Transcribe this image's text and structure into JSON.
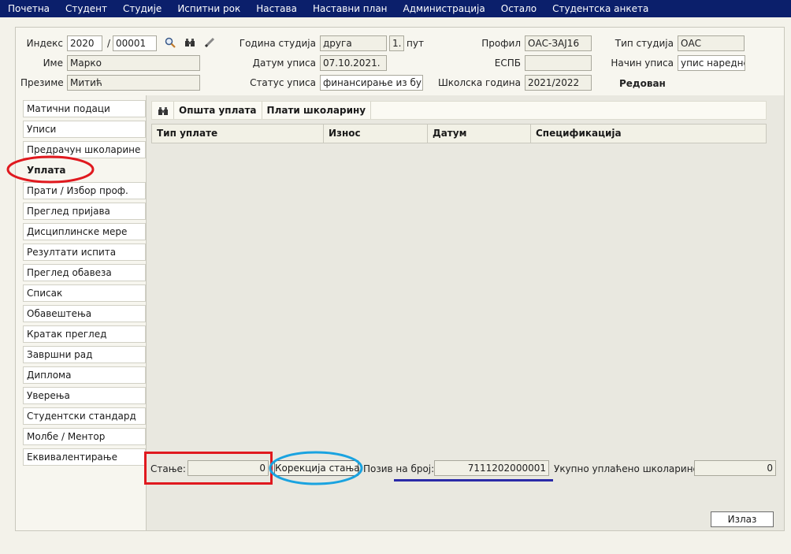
{
  "menu": [
    "Почетна",
    "Студент",
    "Студије",
    "Испитни рок",
    "Настава",
    "Наставни план",
    "Администрација",
    "Остало",
    "Студентска анкета"
  ],
  "header": {
    "index_label": "Индекс",
    "index_year": "2020",
    "index_sep": "/",
    "index_number": "00001",
    "name_label": "Име",
    "name_value": "Марко",
    "surname_label": "Презиме",
    "surname_value": "Митић",
    "year_label": "Година студија",
    "year_value": "друга",
    "year_times": "1.",
    "year_times_suffix": "пут",
    "enroll_date_label": "Датум уписа",
    "enroll_date_value": "07.10.2021.",
    "enroll_status_label": "Статус уписа",
    "enroll_status_value": "финансирање из буџ",
    "profile_label": "Профил",
    "profile_value": "ОАС-ЗАЈ16",
    "espb_label": "ЕСПБ",
    "espb_value": "",
    "school_year_label": "Школска година",
    "school_year_value": "2021/2022",
    "study_type_label": "Тип студија",
    "study_type_value": "ОАС",
    "enroll_mode_label": "Начин уписа",
    "enroll_mode_value": "упис наредне",
    "status_text": "Редован"
  },
  "icons": {
    "search": "search-icon",
    "binoculars": "binoculars-icon",
    "edit": "pencil-icon"
  },
  "sidebar": {
    "items": [
      "Матични подаци",
      "Уписи",
      "Предрачун школарине",
      "Уплата",
      "Прати / Избор проф.",
      "Преглед пријава",
      "Дисциплинске мере",
      "Резултати испита",
      "Преглед обавеза",
      "Списак",
      "Обавештења",
      "Кратак преглед",
      "Завршни рад",
      "Диплома",
      "Уверења",
      "Студентски стандард",
      "Молбе / Ментор",
      "Еквивалентирање"
    ],
    "active": "Уплата"
  },
  "toolbar": {
    "general_payment": "Општа уплата",
    "pay_tuition": "Плати школарину"
  },
  "table": {
    "columns": [
      "Тип уплате",
      "Износ",
      "Датум",
      "Спецификација"
    ],
    "rows": []
  },
  "footer": {
    "balance_label": "Стање:",
    "balance_value": "0",
    "correction_button": "Корекција стања",
    "reference_label": "Позив на број:",
    "reference_value": "7111202000001",
    "total_paid_label": "Укупно уплаћено школарине:",
    "total_paid_value": "0",
    "exit_button": "Излаз"
  },
  "colors": {
    "menubar": "#0b1f6b",
    "annotation_red": "#e0191f",
    "annotation_blue": "#1aa3e0",
    "underline": "#2a2aa8"
  }
}
